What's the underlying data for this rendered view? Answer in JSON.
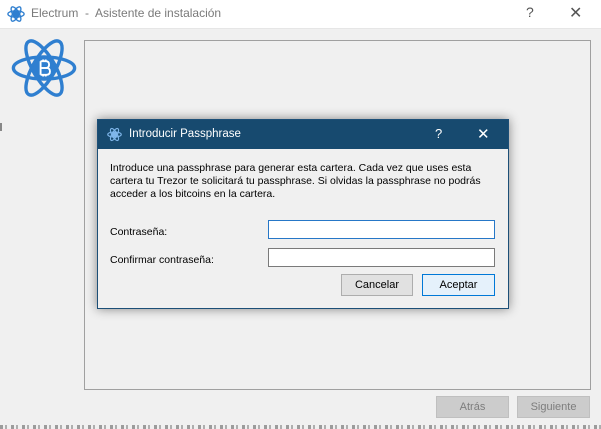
{
  "window": {
    "title": "Electrum  -  Asistente de instalación",
    "help_glyph": "?",
    "close_glyph": "✕",
    "icon": "electrum-logo-icon",
    "accent_color": "#2f7fd0"
  },
  "wizard": {
    "back_label": "Atrás",
    "next_label": "Siguiente"
  },
  "dialog": {
    "title": "Introducir Passphrase",
    "help_glyph": "?",
    "close_glyph": "✕",
    "titlebar_color": "#174a6f",
    "message": "Introduce una passphrase para generar esta cartera. Cada vez que uses esta cartera tu  Trezor te solicitará tu passphrase. Si olvidas la passphrase no podrás acceder a los bitcoins en la cartera.",
    "password_label": "Contraseña:",
    "password_value": "",
    "confirm_label": "Confirmar contraseña:",
    "confirm_value": "",
    "cancel_label": "Cancelar",
    "ok_label": "Aceptar"
  }
}
